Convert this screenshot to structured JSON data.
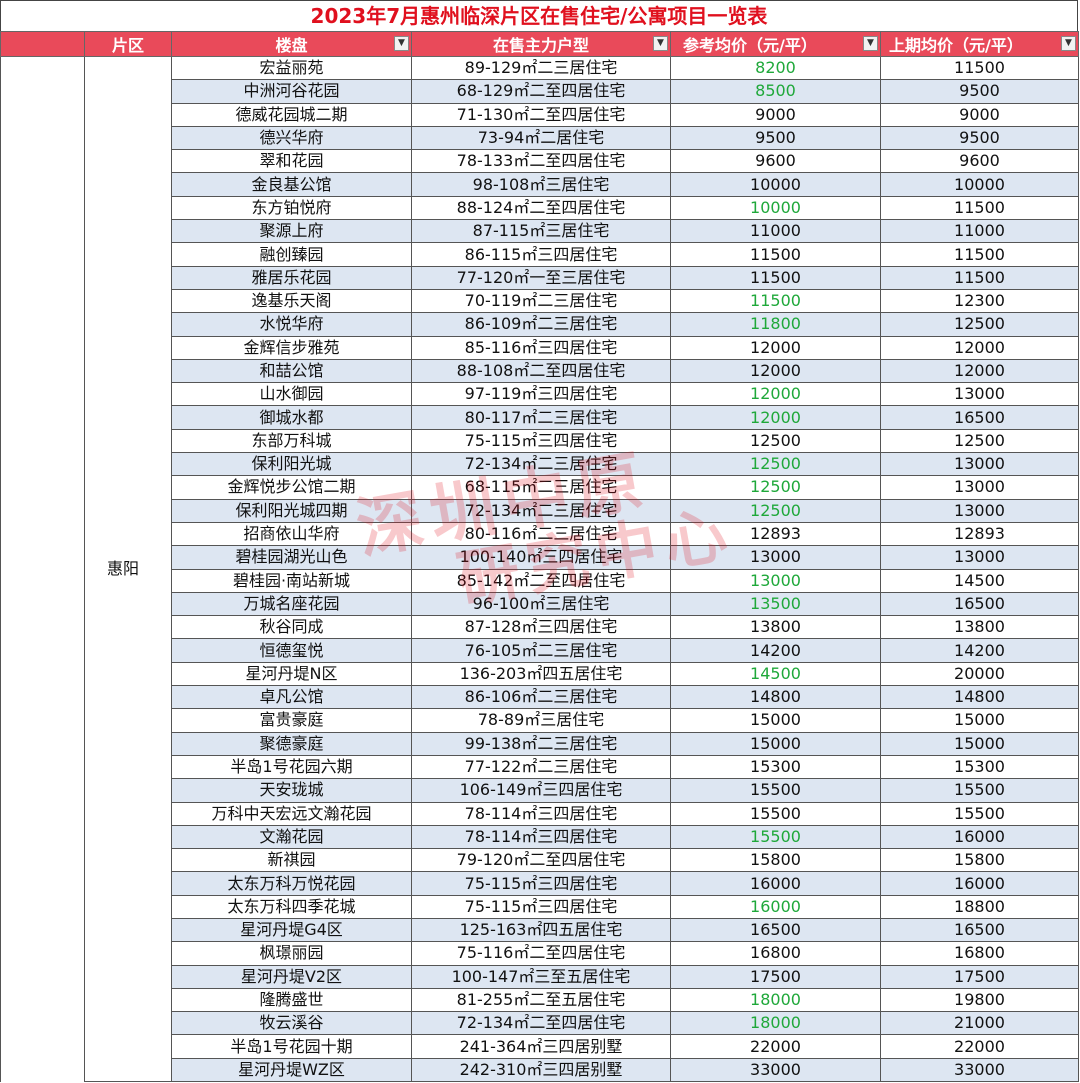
{
  "title": "2023年7月惠州临深片区在售住宅/公寓项目一览表",
  "headers": [
    "片区",
    "楼盘",
    "在售主力户型",
    "参考均价（元/平）",
    "上期均价（元/平）"
  ],
  "dropdown_icon": "▼",
  "district": "惠阳",
  "watermark": {
    "line1": "深圳中原",
    "line2": "研究中心"
  },
  "colors": {
    "title": "#e0101e",
    "header_bg": "#e94a5a",
    "green": "#1fa83a",
    "stripe": "#dde6f2"
  },
  "rows": [
    {
      "name": "宏益丽苑",
      "type": "89-129㎡二三居住宅",
      "price": "8200",
      "prev": "11500",
      "green": true
    },
    {
      "name": "中洲河谷花园",
      "type": "68-129㎡二至四居住宅",
      "price": "8500",
      "prev": "9500",
      "green": true
    },
    {
      "name": "德威花园城二期",
      "type": "71-130㎡二至四居住宅",
      "price": "9000",
      "prev": "9000",
      "green": false
    },
    {
      "name": "德兴华府",
      "type": "73-94㎡二居住宅",
      "price": "9500",
      "prev": "9500",
      "green": false
    },
    {
      "name": "翠和花园",
      "type": "78-133㎡二至四居住宅",
      "price": "9600",
      "prev": "9600",
      "green": false
    },
    {
      "name": "金良基公馆",
      "type": "98-108㎡三居住宅",
      "price": "10000",
      "prev": "10000",
      "green": false
    },
    {
      "name": "东方铂悦府",
      "type": "88-124㎡二至四居住宅",
      "price": "10000",
      "prev": "11500",
      "green": true
    },
    {
      "name": "聚源上府",
      "type": "87-115㎡三居住宅",
      "price": "11000",
      "prev": "11000",
      "green": false
    },
    {
      "name": "融创臻园",
      "type": "86-115㎡三四居住宅",
      "price": "11500",
      "prev": "11500",
      "green": false
    },
    {
      "name": "雅居乐花园",
      "type": "77-120㎡一至三居住宅",
      "price": "11500",
      "prev": "11500",
      "green": false
    },
    {
      "name": "逸基乐天阁",
      "type": "70-119㎡二三居住宅",
      "price": "11500",
      "prev": "12300",
      "green": true
    },
    {
      "name": "水悦华府",
      "type": "86-109㎡二三居住宅",
      "price": "11800",
      "prev": "12500",
      "green": true
    },
    {
      "name": "金辉信步雅苑",
      "type": "85-116㎡三四居住宅",
      "price": "12000",
      "prev": "12000",
      "green": false
    },
    {
      "name": "和喆公馆",
      "type": "88-108㎡二至四居住宅",
      "price": "12000",
      "prev": "12000",
      "green": false
    },
    {
      "name": "山水御园",
      "type": "97-119㎡三四居住宅",
      "price": "12000",
      "prev": "13000",
      "green": true
    },
    {
      "name": "御城水都",
      "type": "80-117㎡二三居住宅",
      "price": "12000",
      "prev": "16500",
      "green": true
    },
    {
      "name": "东部万科城",
      "type": "75-115㎡三四居住宅",
      "price": "12500",
      "prev": "12500",
      "green": false
    },
    {
      "name": "保利阳光城",
      "type": "72-134㎡二三居住宅",
      "price": "12500",
      "prev": "13000",
      "green": true
    },
    {
      "name": "金辉悦步公馆二期",
      "type": "68-115㎡二三居住宅",
      "price": "12500",
      "prev": "13000",
      "green": true
    },
    {
      "name": "保利阳光城四期",
      "type": "72-134㎡二三居住宅",
      "price": "12500",
      "prev": "13000",
      "green": true
    },
    {
      "name": "招商依山华府",
      "type": "80-116㎡二三居住宅",
      "price": "12893",
      "prev": "12893",
      "green": false
    },
    {
      "name": "碧桂园湖光山色",
      "type": "100-140㎡三四居住宅",
      "price": "13000",
      "prev": "13000",
      "green": false
    },
    {
      "name": "碧桂园·南站新城",
      "type": "85-142㎡二至四居住宅",
      "price": "13000",
      "prev": "14500",
      "green": true
    },
    {
      "name": "万城名座花园",
      "type": "96-100㎡三居住宅",
      "price": "13500",
      "prev": "16500",
      "green": true
    },
    {
      "name": "秋谷同成",
      "type": "87-128㎡三四居住宅",
      "price": "13800",
      "prev": "13800",
      "green": false
    },
    {
      "name": "恒德玺悦",
      "type": "76-105㎡二三居住宅",
      "price": "14200",
      "prev": "14200",
      "green": false
    },
    {
      "name": "星河丹堤N区",
      "type": "136-203㎡四五居住宅",
      "price": "14500",
      "prev": "20000",
      "green": true
    },
    {
      "name": "卓凡公馆",
      "type": "86-106㎡二三居住宅",
      "price": "14800",
      "prev": "14800",
      "green": false
    },
    {
      "name": "富贵豪庭",
      "type": "78-89㎡三居住宅",
      "price": "15000",
      "prev": "15000",
      "green": false
    },
    {
      "name": "聚德豪庭",
      "type": "99-138㎡二三居住宅",
      "price": "15000",
      "prev": "15000",
      "green": false
    },
    {
      "name": "半岛1号花园六期",
      "type": "77-122㎡二三居住宅",
      "price": "15300",
      "prev": "15300",
      "green": false
    },
    {
      "name": "天安珑城",
      "type": "106-149㎡三四居住宅",
      "price": "15500",
      "prev": "15500",
      "green": false
    },
    {
      "name": "万科中天宏远文瀚花园",
      "type": "78-114㎡三四居住宅",
      "price": "15500",
      "prev": "15500",
      "green": false
    },
    {
      "name": "文瀚花园",
      "type": "78-114㎡三四居住宅",
      "price": "15500",
      "prev": "16000",
      "green": true
    },
    {
      "name": "新祺园",
      "type": "79-120㎡二至四居住宅",
      "price": "15800",
      "prev": "15800",
      "green": false
    },
    {
      "name": "太东万科万悦花园",
      "type": "75-115㎡三四居住宅",
      "price": "16000",
      "prev": "16000",
      "green": false
    },
    {
      "name": "太东万科四季花城",
      "type": "75-115㎡三四居住宅",
      "price": "16000",
      "prev": "18800",
      "green": true
    },
    {
      "name": "星河丹堤G4区",
      "type": "125-163㎡四五居住宅",
      "price": "16500",
      "prev": "16500",
      "green": false
    },
    {
      "name": "枫璟丽园",
      "type": "75-116㎡二至四居住宅",
      "price": "16800",
      "prev": "16800",
      "green": false
    },
    {
      "name": "星河丹堤V2区",
      "type": "100-147㎡三至五居住宅",
      "price": "17500",
      "prev": "17500",
      "green": false
    },
    {
      "name": "隆腾盛世",
      "type": "81-255㎡二至五居住宅",
      "price": "18000",
      "prev": "19800",
      "green": true
    },
    {
      "name": "牧云溪谷",
      "type": "72-134㎡二至四居住宅",
      "price": "18000",
      "prev": "21000",
      "green": true
    },
    {
      "name": "半岛1号花园十期",
      "type": "241-364㎡三四居别墅",
      "price": "22000",
      "prev": "22000",
      "green": false
    },
    {
      "name": "星河丹堤WZ区",
      "type": "242-310㎡三四居别墅",
      "price": "33000",
      "prev": "33000",
      "green": false
    }
  ]
}
